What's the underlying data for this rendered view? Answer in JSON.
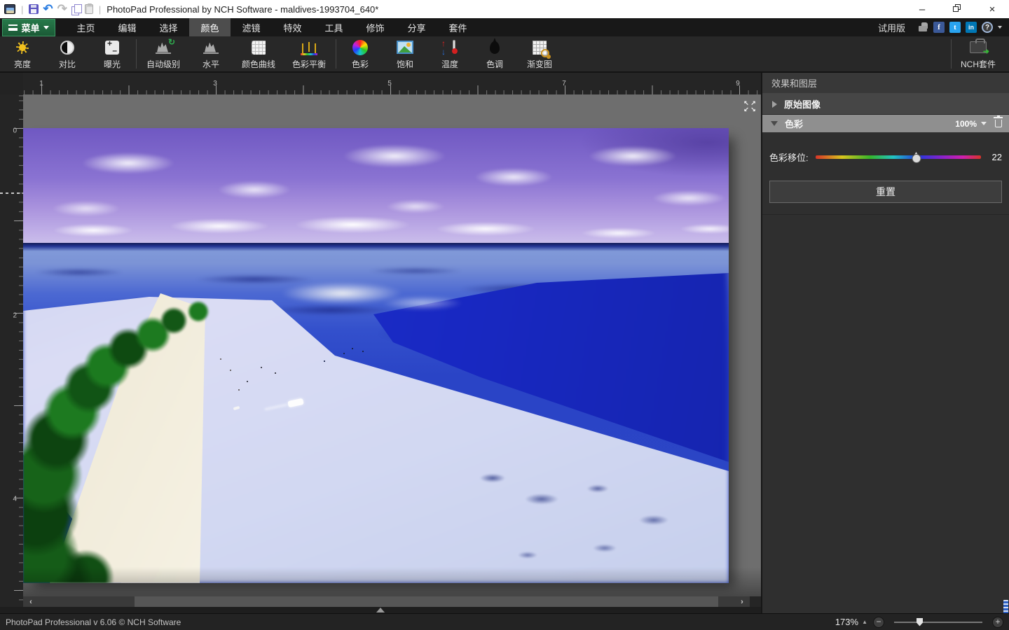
{
  "titlebar": {
    "title": "PhotoPad Professional by NCH Software - maldives-1993704_640*",
    "window_controls": {
      "minimize": "–",
      "close": "×"
    }
  },
  "menubar": {
    "menu_button_label": "菜单",
    "tabs": [
      {
        "label": "主页"
      },
      {
        "label": "编辑"
      },
      {
        "label": "选择"
      },
      {
        "label": "颜色",
        "active": true
      },
      {
        "label": "滤镜"
      },
      {
        "label": "特效"
      },
      {
        "label": "工具"
      },
      {
        "label": "修饰"
      },
      {
        "label": "分享"
      },
      {
        "label": "套件"
      }
    ],
    "trial_label": "试用版"
  },
  "toolbar": {
    "items": [
      {
        "label": "亮度",
        "icon": "brightness-sun"
      },
      {
        "label": "对比",
        "icon": "contrast-circle"
      },
      {
        "label": "曝光",
        "icon": "exposure-plus-minus"
      },
      {
        "label": "自动级别",
        "icon": "auto-levels-histogram"
      },
      {
        "label": "水平",
        "icon": "levels-histogram"
      },
      {
        "label": "颜色曲线",
        "icon": "color-curves-grid"
      },
      {
        "label": "色彩平衡",
        "icon": "color-balance-scales"
      },
      {
        "label": "色彩",
        "icon": "color-wheel"
      },
      {
        "label": "饱和",
        "icon": "saturation-photo"
      },
      {
        "label": "温度",
        "icon": "temperature-thermometer"
      },
      {
        "label": "色调",
        "icon": "tint-droplet"
      },
      {
        "label": "渐变图",
        "icon": "gradient-map-magnifier"
      }
    ],
    "nch_item_label": "NCH套件"
  },
  "rulers": {
    "horizontal_marks": [
      {
        "label": "1"
      },
      {
        "label": "3"
      },
      {
        "label": "5"
      },
      {
        "label": "7"
      },
      {
        "label": "9"
      }
    ],
    "vertical_marks": [
      {
        "label": "0"
      },
      {
        "label": "2"
      },
      {
        "label": "4"
      }
    ]
  },
  "side_panel": {
    "header": "效果和图层",
    "original_section_title": "原始图像",
    "color_section_title": "色彩",
    "color_opacity": "100%",
    "hue_slider": {
      "label": "色彩移位:",
      "value": "22",
      "position_pct": 61
    },
    "reset_label": "重置"
  },
  "statusbar": {
    "app_info": "PhotoPad Professional v 6.06 © NCH Software",
    "zoom_level": "173%"
  },
  "colors": {
    "menu_green": "#1f6f41",
    "facebook_blue": "#3b5998",
    "twitter_blue": "#29a3ef",
    "linkedin_blue": "#0077b5",
    "undo_blue": "#2a7de1",
    "sky_purple": "#8a73d2",
    "deep_sea_blue": "#1c2fd0"
  }
}
